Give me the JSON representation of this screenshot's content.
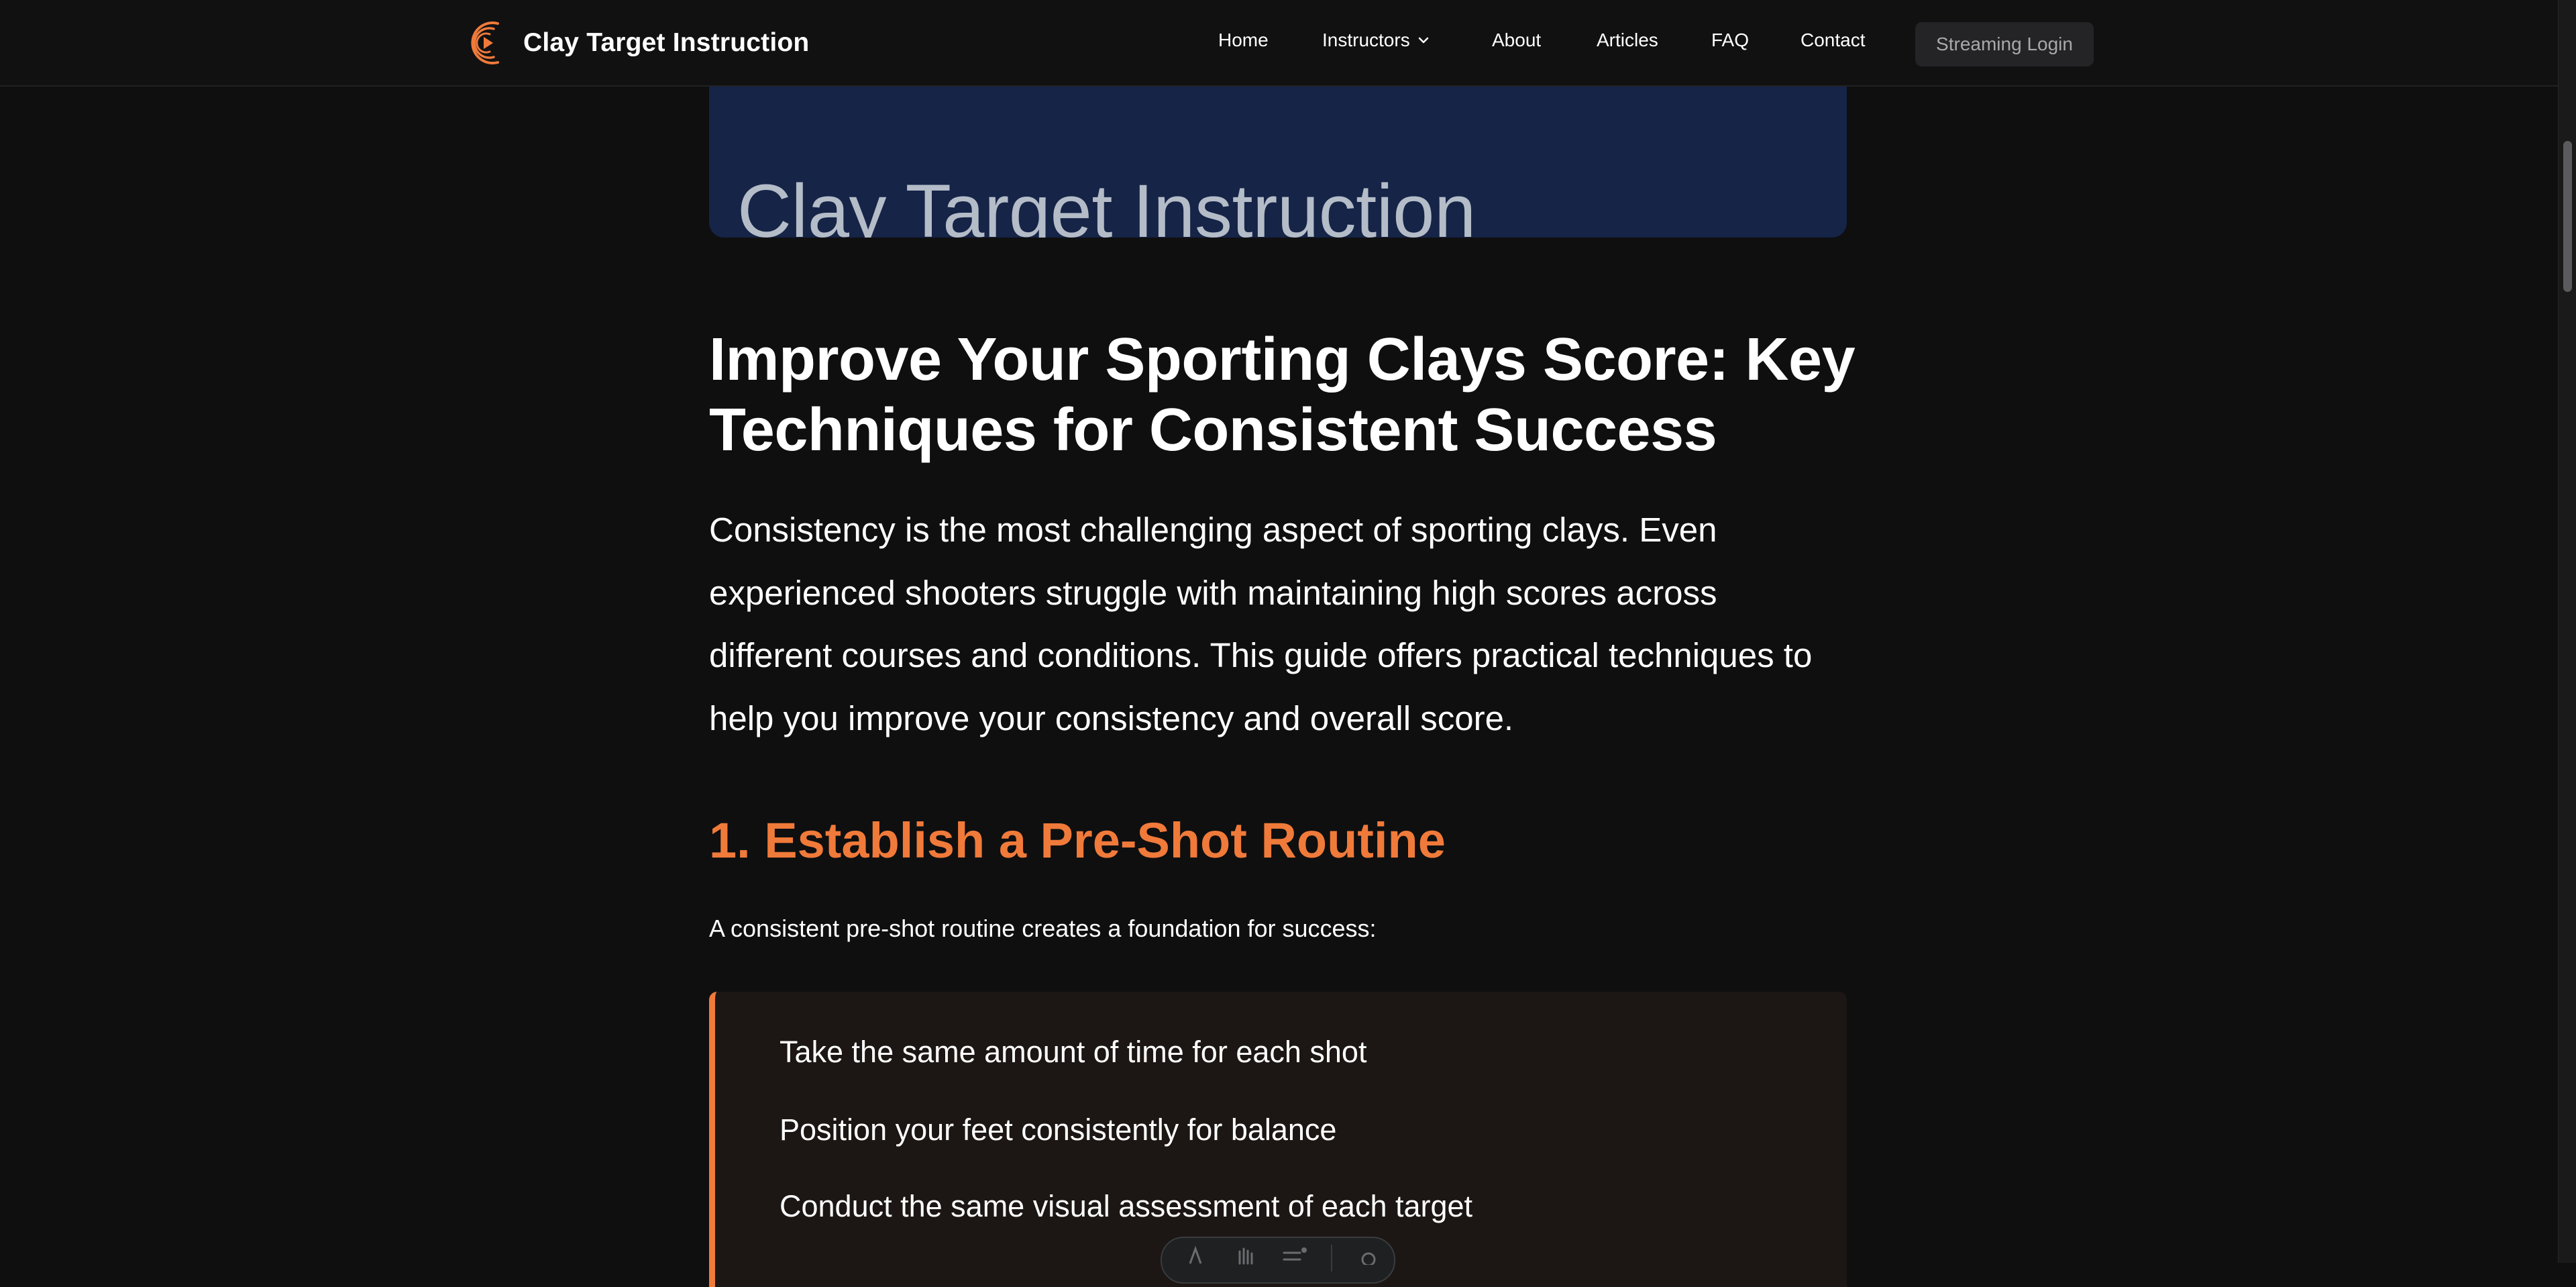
{
  "site": {
    "title": "Clay Target Instruction"
  },
  "nav": {
    "items": [
      {
        "label": "Home"
      },
      {
        "label": "Instructors"
      },
      {
        "label": "About"
      },
      {
        "label": "Articles"
      },
      {
        "label": "FAQ"
      },
      {
        "label": "Contact"
      }
    ],
    "streaming_login": "Streaming Login"
  },
  "hero": {
    "text": "Clay Target Instruction"
  },
  "article": {
    "title": "Improve Your Sporting Clays Score: Key Techniques for Consistent Success",
    "intro": "Consistency is the most challenging aspect of sporting clays. Even experienced shooters struggle with maintaining high scores across different courses and conditions. This guide offers practical techniques to help you improve your consistency and overall score.",
    "section1": {
      "heading": "1. Establish a Pre-Shot Routine",
      "lead": "A consistent pre-shot routine creates a foundation for success:",
      "tips": [
        "Take the same amount of time for each shot",
        "Position your feet consistently for balance",
        "Conduct the same visual assessment of each target"
      ]
    }
  },
  "colors": {
    "accent": "#f07a3a",
    "background": "#0f0f10",
    "hero_bg": "#152447"
  },
  "icons": {
    "logo": "play-orbit-logo-icon",
    "dropdown": "chevron-down-icon"
  }
}
